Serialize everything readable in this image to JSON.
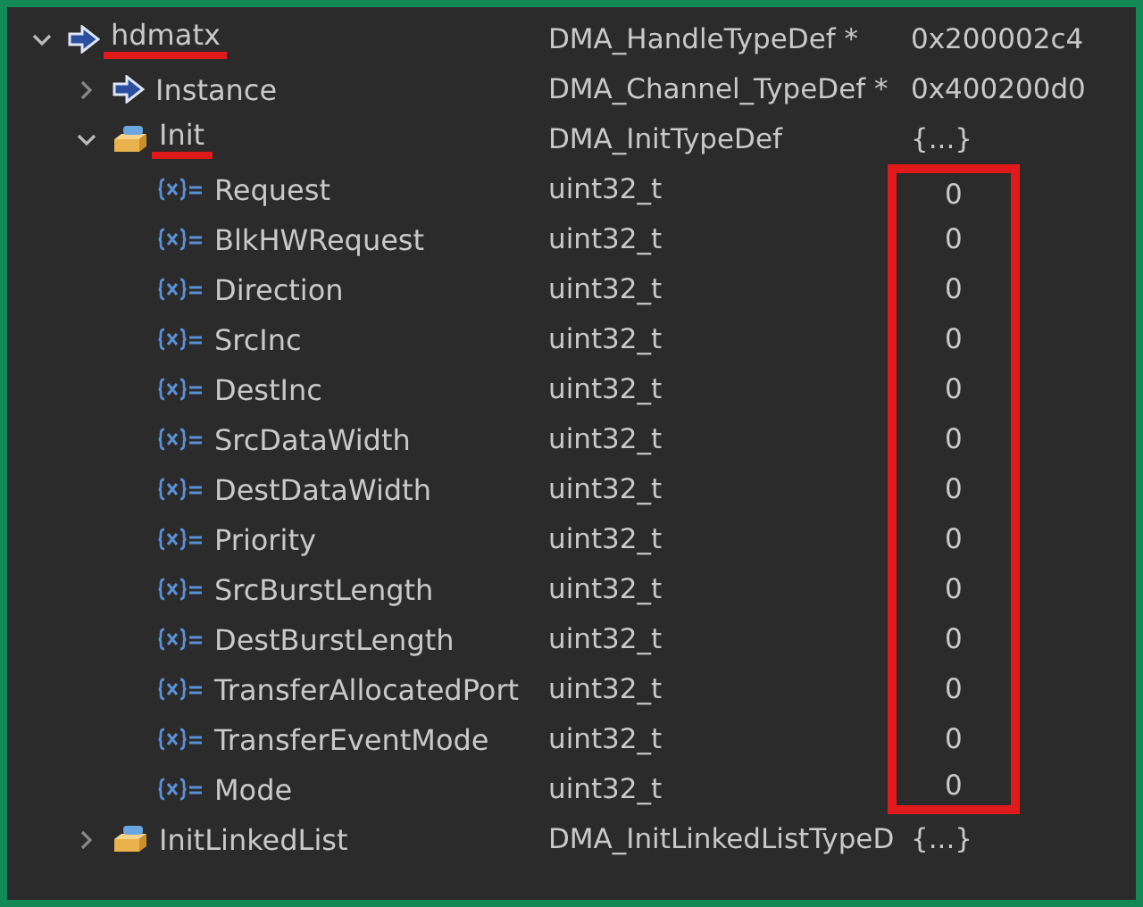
{
  "variables": [
    {
      "name": "hdmatx",
      "type": "DMA_HandleTypeDef *",
      "value": "0x200002c4",
      "kind": "pointer",
      "expanded": true,
      "underlined": true,
      "children": [
        {
          "name": "Instance",
          "type": "DMA_Channel_TypeDef *",
          "value": "0x400200d0",
          "kind": "pointer",
          "expanded": false
        },
        {
          "name": "Init",
          "type": "DMA_InitTypeDef",
          "value": "{...}",
          "kind": "struct",
          "expanded": true,
          "underlined": true,
          "children": [
            {
              "name": "Request",
              "type": "uint32_t",
              "value": "0",
              "kind": "field",
              "boxed": true
            },
            {
              "name": "BlkHWRequest",
              "type": "uint32_t",
              "value": "0",
              "kind": "field",
              "boxed": true
            },
            {
              "name": "Direction",
              "type": "uint32_t",
              "value": "0",
              "kind": "field",
              "boxed": true
            },
            {
              "name": "SrcInc",
              "type": "uint32_t",
              "value": "0",
              "kind": "field",
              "boxed": true
            },
            {
              "name": "DestInc",
              "type": "uint32_t",
              "value": "0",
              "kind": "field",
              "boxed": true
            },
            {
              "name": "SrcDataWidth",
              "type": "uint32_t",
              "value": "0",
              "kind": "field",
              "boxed": true
            },
            {
              "name": "DestDataWidth",
              "type": "uint32_t",
              "value": "0",
              "kind": "field",
              "boxed": true
            },
            {
              "name": "Priority",
              "type": "uint32_t",
              "value": "0",
              "kind": "field",
              "boxed": true
            },
            {
              "name": "SrcBurstLength",
              "type": "uint32_t",
              "value": "0",
              "kind": "field",
              "boxed": true
            },
            {
              "name": "DestBurstLength",
              "type": "uint32_t",
              "value": "0",
              "kind": "field",
              "boxed": true
            },
            {
              "name": "TransferAllocatedPort",
              "type": "uint32_t",
              "value": "0",
              "kind": "field",
              "boxed": true
            },
            {
              "name": "TransferEventMode",
              "type": "uint32_t",
              "value": "0",
              "kind": "field",
              "boxed": true
            },
            {
              "name": "Mode",
              "type": "uint32_t",
              "value": "0",
              "kind": "field",
              "boxed": true
            }
          ]
        },
        {
          "name": "InitLinkedList",
          "type": "DMA_InitLinkedListTypeD",
          "value": "{...}",
          "kind": "struct",
          "expanded": false
        }
      ]
    }
  ]
}
